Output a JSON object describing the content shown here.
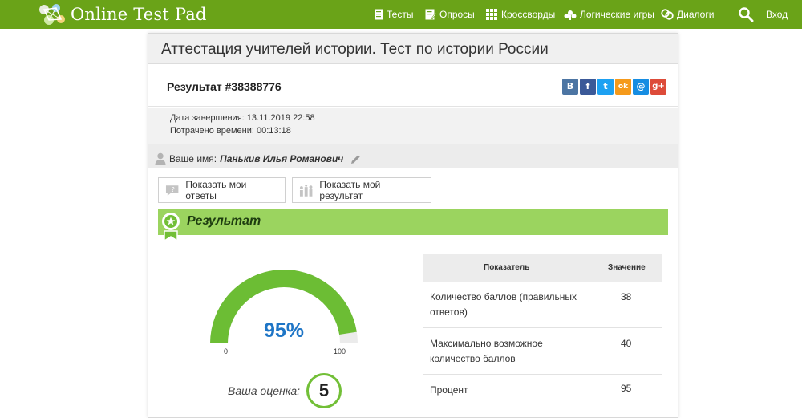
{
  "brand": {
    "name": "Online Test Pad"
  },
  "nav": {
    "items": [
      {
        "label": "Тесты",
        "icon": "document-icon"
      },
      {
        "label": "Опросы",
        "icon": "survey-icon"
      },
      {
        "label": "Кроссворды",
        "icon": "grid-icon"
      },
      {
        "label": "Логические игры",
        "icon": "puzzle-icon"
      },
      {
        "label": "Диалоги",
        "icon": "chat-icon"
      }
    ],
    "search_icon": "search-icon",
    "login_label": "Вход"
  },
  "page": {
    "title": "Аттестация учителей истории. Тест по истории России",
    "result_number": "Результат #38388776",
    "share": [
      "В",
      "f",
      "t",
      "ok",
      "@",
      "g+"
    ],
    "finished_label": "Дата завершения:",
    "finished_value": "13.11.2019 22:58",
    "spent_label": "Потрачено времени:",
    "spent_value": "00:13:18",
    "name_label": "Ваше имя:",
    "name_value": "Панькив Илья Романович"
  },
  "buttons": {
    "show_answers": "Показать мои ответы",
    "show_result": "Показать мой результат"
  },
  "result": {
    "heading": "Результат",
    "gauge": {
      "percent_text": "95%",
      "fraction": 0.95,
      "min": "0",
      "max": "100"
    },
    "grade_label": "Ваша оценка:",
    "grade_value": "5"
  },
  "table": {
    "headers": [
      "Показатель",
      "Значение"
    ],
    "rows": [
      {
        "label": "Количество баллов (правильных ответов)",
        "value": "38"
      },
      {
        "label": "Максимально возможное количество баллов",
        "value": "40"
      },
      {
        "label": "Процент",
        "value": "95"
      }
    ]
  },
  "colors": {
    "accent": "#6aa318",
    "band": "#9bd45f",
    "gauge_fill": "#6cbd34",
    "gauge_empty": "#ebebeb",
    "percent": "#1e75c6"
  }
}
